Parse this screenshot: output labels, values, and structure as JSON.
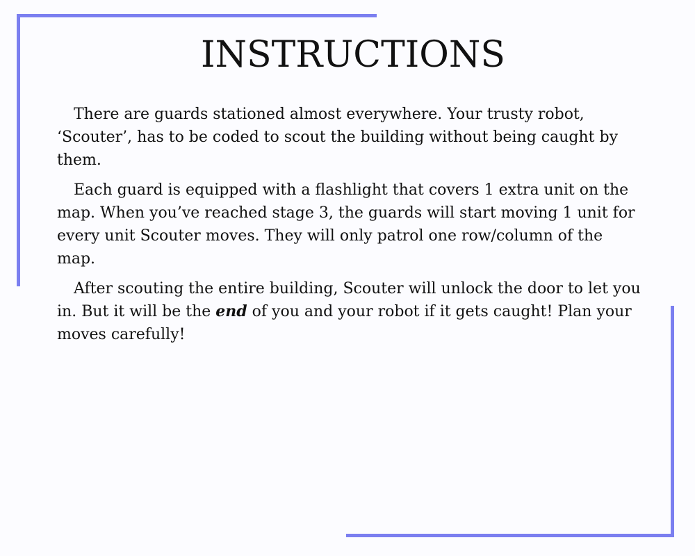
{
  "title": "INSTRUCTIONS",
  "paragraphs": [
    {
      "text": "There are guards stationed almost everywhere. Your trusty robot, ‘Scouter’, has to be coded to scout the building without being caught by them."
    },
    {
      "text": "Each guard is equipped with a flashlight that covers 1 extra unit on the map. When you’ve reached stage 3, the guards will start moving 1 unit for every unit Scouter moves. They will only patrol one row/column of the map."
    },
    {
      "before": "After scouting the entire building, Scouter will unlock the door to let you in. But it will be the ",
      "emphasis": "end",
      "after": " of you and your robot if it gets caught! Plan your moves carefully!"
    }
  ],
  "colors": {
    "accent": "#7b7ff0",
    "background": "#fcfcff",
    "text": "#111111"
  }
}
